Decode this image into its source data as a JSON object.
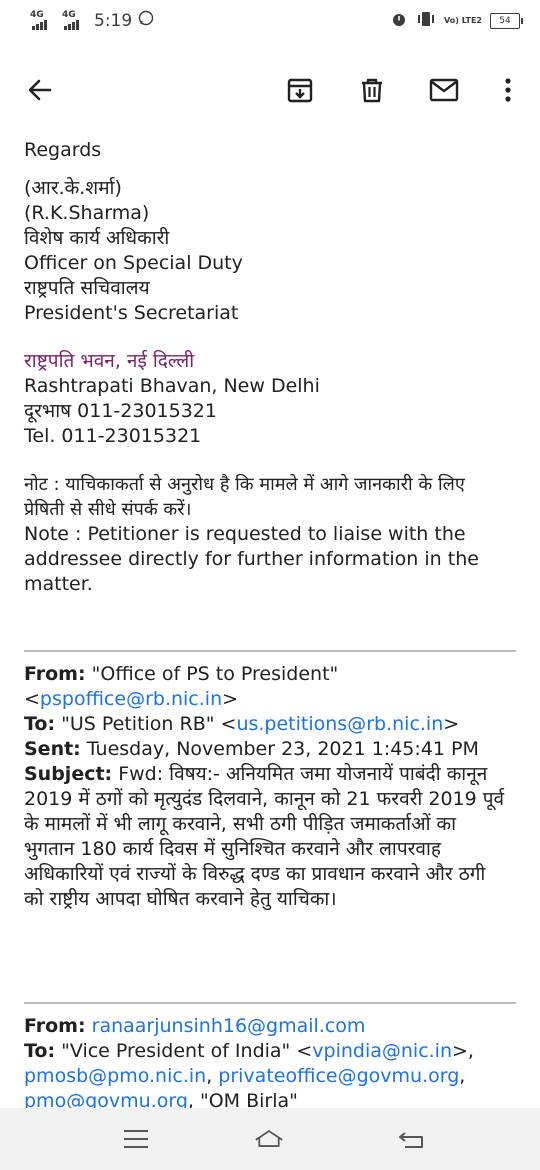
{
  "status_bar": {
    "signal1": "4G",
    "signal2": "4G",
    "time": "5:19",
    "network": "Vo) LTE2",
    "battery": "54"
  },
  "toolbar": {
    "back": "arrow-left-icon",
    "archive": "archive-icon",
    "delete": "trash-icon",
    "mark_unread": "mail-icon",
    "more": "more-vert-icon"
  },
  "signature": {
    "regards": "Regards",
    "name_hi": "(आर.के.शर्मा)",
    "name_en": "(R.K.Sharma)",
    "title_hi": "विशेष कार्य अधिकारी",
    "title_en": "Officer on Special Duty",
    "office_hi": "राष्ट्रपति सचिवालय",
    "office_en": "President's Secretariat",
    "place_hi": "राष्ट्रपति भवन, नई दिल्ली",
    "place_en": "Rashtrapati Bhavan, New Delhi",
    "phone_hi": "दूरभाष 011-23015321",
    "phone_en": "Tel. 011-23015321"
  },
  "note": {
    "hi_line1": "नोट : याचिकाकर्ता से अनुरोध है कि मामले में आगे जानकारी के लिए",
    "hi_line2": "प्रेषिती से सीधे संपर्क करें।",
    "en_line1": "Note : Petitioner is requested to liaise with the",
    "en_line2": "addressee directly for further information in the",
    "en_line3": "matter."
  },
  "forwarded1": {
    "from_label": "From:",
    "from_name": " \"Office of PS to President\"",
    "from_email_open": "<",
    "from_email": "pspoffice@rb.nic.in",
    "from_email_close": ">",
    "to_label": "To:",
    "to_name": " \"US Petition RB\" <",
    "to_email": "us.petitions@rb.nic.in",
    "to_close": ">",
    "sent_label": "Sent:",
    "sent_value": " Tuesday, November 23, 2021 1:45:41 PM",
    "subject_label": "Subject:",
    "subject_l1": " Fwd: विषय:- अनियमित जमा योजनायें पाबंदी कानून",
    "subject_l2": "2019 में ठगों को मृत्युदंड दिलवाने, कानून को 21 फरवरी 2019 पूर्व",
    "subject_l3": "के मामलों में भी लागू करवाने, सभी ठगी पीड़ित जमाकर्ताओं का",
    "subject_l4": "भुगतान 180 कार्य दिवस में सुनिश्चित करवाने और लापरवाह",
    "subject_l5": "अधिकारियों एवं राज्यों के विरुद्ध दण्ड का प्रावधान करवाने और ठगी",
    "subject_l6": "को राष्ट्रीय आपदा घोषित करवाने हेतु याचिका।"
  },
  "forwarded2": {
    "from_label": "From:",
    "from_email": "ranaarjunsinh16@gmail.com",
    "to_label": "To:",
    "to_name": " \"Vice President of India\" <",
    "to_email1": "vpindia@nic.in",
    "to_sep1": ">,",
    "to_email2": "pmosb@pmo.nic.in",
    "to_sep2": ", ",
    "to_email3": "privateoffice@govmu.org",
    "to_sep3": ",",
    "to_email4": "pmo@govmu.org",
    "to_tail": ", \"OM Birla\""
  },
  "nav_bar": {
    "menu": "menu-icon",
    "home": "home-icon",
    "back": "back-icon"
  }
}
